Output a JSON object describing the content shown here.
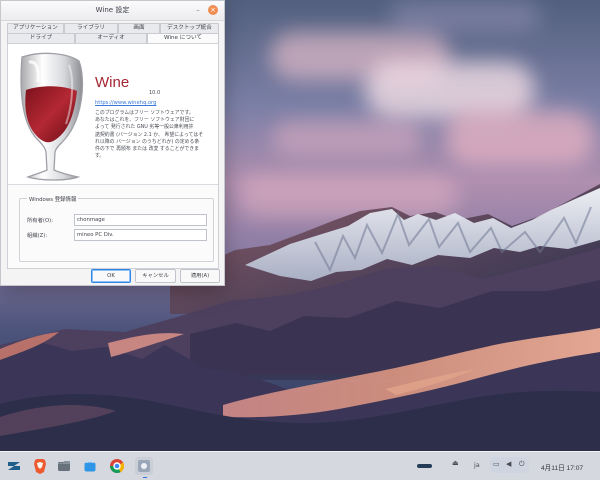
{
  "window": {
    "title": "Wine 設定",
    "tabs_row1": [
      "アプリケーション",
      "ライブラリ",
      "画面",
      "デスクトップ統合"
    ],
    "tabs_row2": [
      "ドライブ",
      "オーディオ",
      "Wine について"
    ],
    "active_tab": "Wine について"
  },
  "about": {
    "app_name": "Wine",
    "version": "10.0",
    "homepage": "https://www.winehq.org",
    "license_text": "このプログラムはフリー ソフトウェアです。\nあなたはこれを、フリー ソフトウェア財団に\nよって 発行された GNU 劣等一般公衆利用許\n諾契約書 (バージョン 2.1 か、 希望によってはそ\nれ以降の バージョン のうちどれか) の定める条\n件の下で 再頒布 または 改変 することができま\nす。"
  },
  "registration": {
    "group_title": "Windows 登録情報",
    "owner_label": "所有者(O):",
    "owner_value": "chonmage",
    "organization_label": "組織(Z):",
    "organization_value": "mineo PC Div."
  },
  "buttons": {
    "ok": "OK",
    "cancel": "キャンセル",
    "apply": "適用(A)"
  },
  "taskbar": {
    "tray_language": "ja",
    "clock": "4月11日 17:07"
  },
  "icons": {
    "desktop": "zorin-logo-icon",
    "apps": [
      "brave-browser-icon",
      "files-icon",
      "software-store-icon",
      "chrome-icon",
      "wine-configuration-icon"
    ],
    "tray": [
      "eject-icon",
      "screen-icon",
      "volume-icon",
      "power-icon"
    ]
  },
  "colors": {
    "wine_red": "#a52632",
    "ok_focus": "#2f85e4",
    "taskbar": "#eef0f5"
  }
}
